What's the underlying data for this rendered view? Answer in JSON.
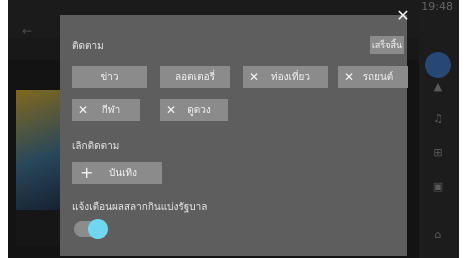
{
  "status_bar": {
    "time": "19:48"
  },
  "background": {
    "back_icon": "arrow-left-icon",
    "side_icons": [
      "chevron-up-icon",
      "music-icon",
      "grid-icon",
      "lock-icon",
      "home-icon"
    ]
  },
  "dialog": {
    "close_icon": "close-icon",
    "following_title": "ติดตาม",
    "done_label": "เสร็จสิ้น",
    "following_chips": [
      {
        "label": "ข่าว",
        "removable": false
      },
      {
        "label": "ลอตเตอรี่",
        "removable": false
      },
      {
        "label": "ท่องเที่ยว",
        "removable": true
      },
      {
        "label": "รถยนต์",
        "removable": true
      },
      {
        "label": "กีฬา",
        "removable": true
      },
      {
        "label": "ดูดวง",
        "removable": true
      }
    ],
    "unfollow_title": "เลิกติดตาม",
    "unfollowed_chips": [
      {
        "label": "บันเทิง",
        "icon": "plus-icon"
      }
    ],
    "notification_label": "แจ้งเตือนผลสลากกินแบ่งรัฐบาล",
    "notification_toggle": true,
    "accent_color": "#6fd8f0"
  }
}
